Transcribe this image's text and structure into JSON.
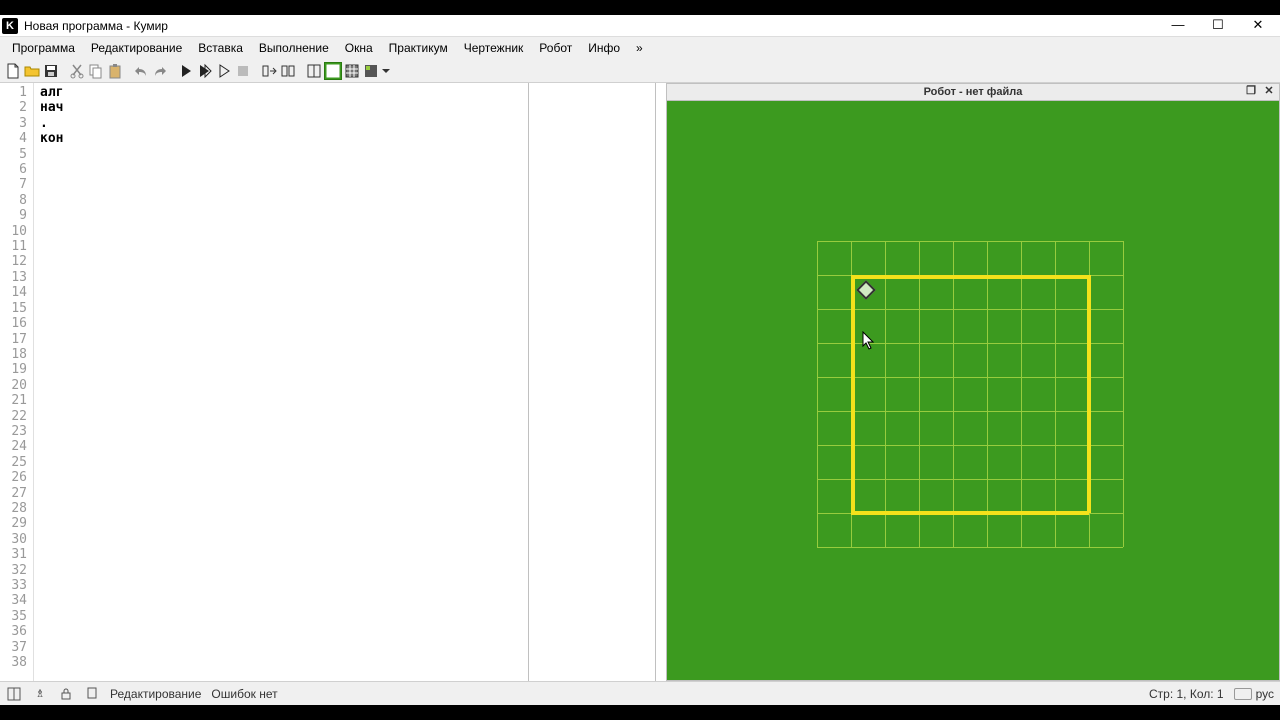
{
  "titlebar": {
    "app_letter": "K",
    "title": "Новая программа - Кумир"
  },
  "menu": {
    "items": [
      "Программа",
      "Редактирование",
      "Вставка",
      "Выполнение",
      "Окна",
      "Практикум",
      "Чертежник",
      "Робот",
      "Инфо",
      "»"
    ]
  },
  "toolbar_icons": [
    "new-file",
    "open-file",
    "save-file",
    "sep",
    "cut",
    "copy",
    "paste",
    "sep",
    "undo",
    "redo",
    "sep",
    "run",
    "run-fast",
    "run-step",
    "stop",
    "sep",
    "step-into",
    "step-over",
    "sep",
    "layout-1",
    "layout-2",
    "layout-3",
    "layout-4",
    "layout-dropdown"
  ],
  "editor": {
    "line_count": 38,
    "lines": {
      "1": "алг",
      "2": "нач",
      "3": ".",
      "4": "кон"
    }
  },
  "robot_panel": {
    "title": "Робот - нет файла",
    "grid": {
      "cols": 7,
      "rows": 7,
      "cell": 34,
      "robot_cell": [
        0,
        0
      ]
    }
  },
  "status": {
    "mode": "Редактирование",
    "errors": "Ошибок нет",
    "cursor": "Стр: 1, Кол: 1",
    "lang": "рус"
  }
}
